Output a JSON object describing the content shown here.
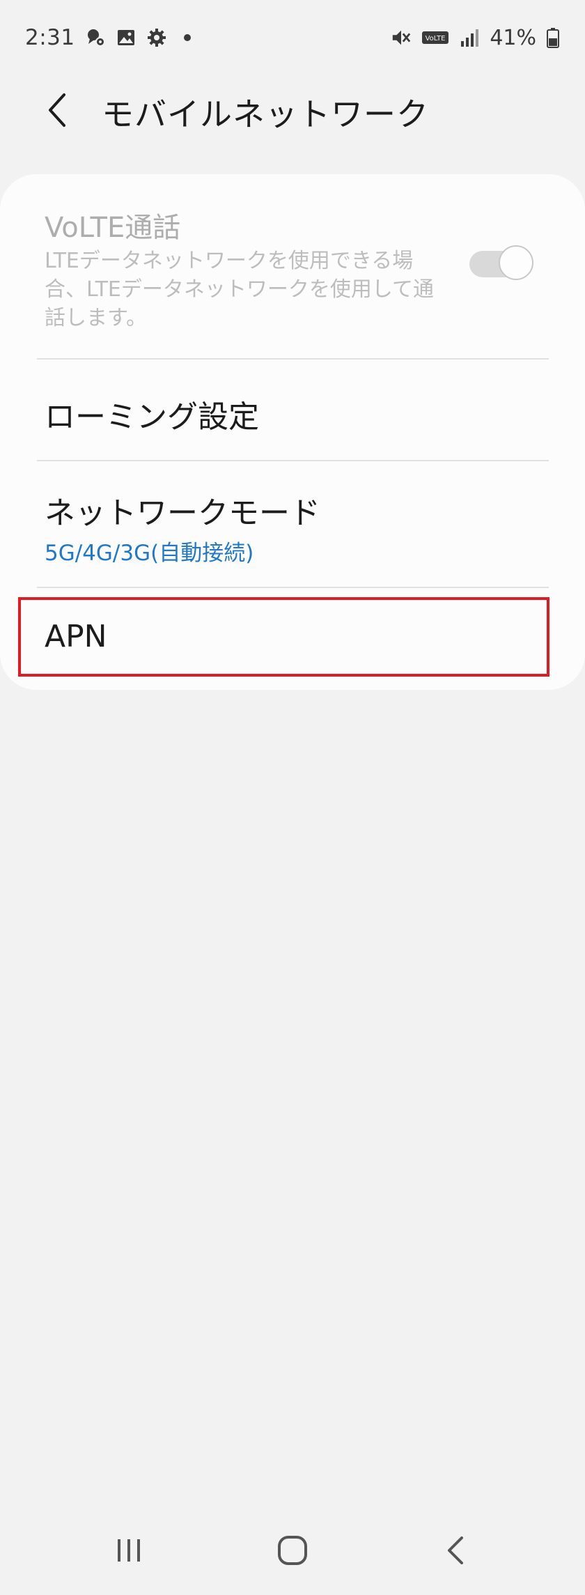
{
  "status_bar": {
    "time": "2:31",
    "battery": "41%",
    "left_icons": [
      "bubble-gear-icon",
      "gallery-icon",
      "settings-gear-icon",
      "dot-icon"
    ],
    "right_icons": [
      "mute-icon",
      "volte-icon",
      "signal-icon",
      "battery-icon"
    ],
    "volte_badge": "VoLTE"
  },
  "header": {
    "title": "モバイルネットワーク",
    "back_icon": "chevron-left-icon"
  },
  "settings": {
    "volte": {
      "title": "VoLTE通話",
      "description": "LTEデータネットワークを使用できる場合、LTEデータネットワークを使用して通話します。",
      "enabled": false,
      "toggle_on": true
    },
    "roaming": {
      "label": "ローミング設定"
    },
    "network_mode": {
      "label": "ネットワークモード",
      "value": "5G/4G/3G(自動接続)"
    },
    "apn": {
      "label": "APN"
    }
  },
  "colors": {
    "accent": "#1f78c9",
    "highlight": "#e01b24",
    "background": "#f2f2f2",
    "card": "#fcfcfc"
  },
  "nav_bar": {
    "icons": [
      "recent-apps-icon",
      "home-icon",
      "back-icon"
    ]
  }
}
